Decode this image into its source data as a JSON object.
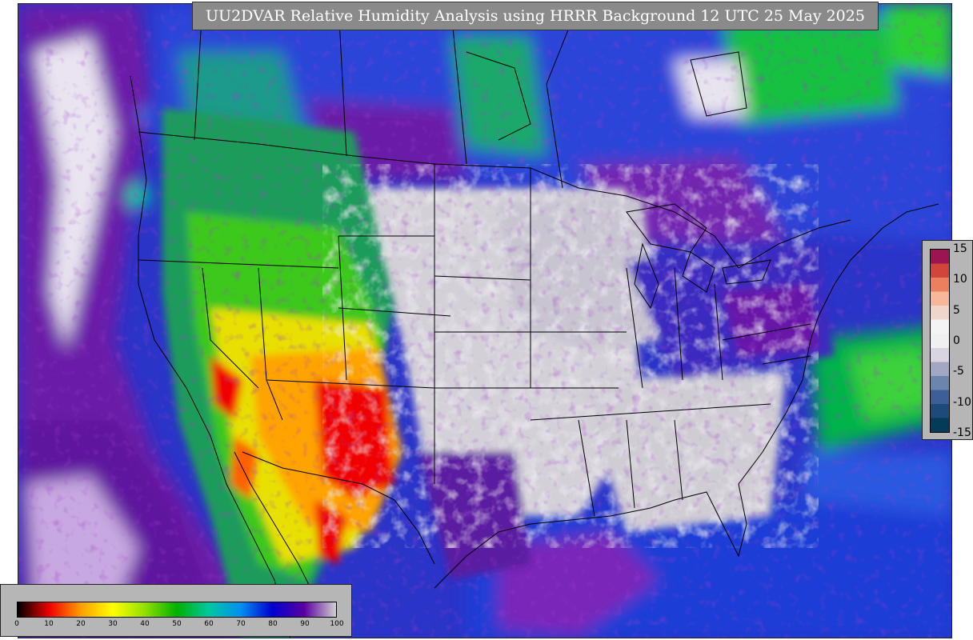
{
  "title": "UU2DVAR Relative Humidity Analysis using HRRR Background 12 UTC 25 May 2025",
  "humidity_colorbar": {
    "ticks": [
      "0",
      "10",
      "20",
      "30",
      "40",
      "50",
      "60",
      "70",
      "80",
      "90",
      "100"
    ],
    "range": [
      0,
      100
    ],
    "colors": [
      "#000000",
      "#f00000",
      "#ffa000",
      "#ffff00",
      "#90e000",
      "#00b000",
      "#00c8a0",
      "#0090f0",
      "#0000d0",
      "#5a00a0",
      "#cfcfcf"
    ]
  },
  "difference_colorbar": {
    "ticks": [
      "15",
      "10",
      "5",
      "0",
      "-5",
      "-10",
      "-15"
    ],
    "range": [
      -15,
      15
    ],
    "colors": [
      "#9c1451",
      "#d2453a",
      "#ec7f5d",
      "#f7b79a",
      "#efd6cb",
      "#f4f4f4",
      "#f0f0f0",
      "#d8d4e0",
      "#a3a8c2",
      "#6b86ad",
      "#3c5f97",
      "#1d4a78",
      "#053b5a"
    ]
  },
  "map_colors": {
    "ocean_moist": "#1f3ed6",
    "very_moist": "#4a0c9a",
    "saturated": "#cfcfcf",
    "green": "#1fc41f",
    "yellow": "#f2e600",
    "orange": "#ffa300",
    "red": "#f00000",
    "boundary": "#000000"
  }
}
